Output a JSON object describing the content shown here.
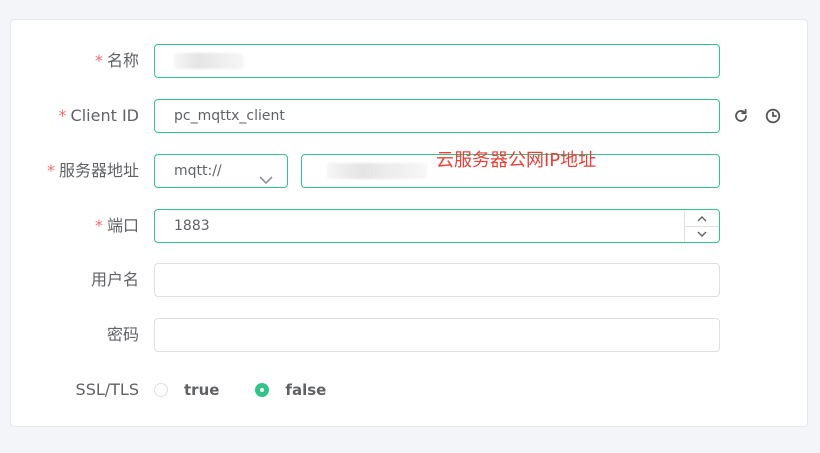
{
  "form": {
    "name": {
      "label": "名称",
      "required": true
    },
    "client_id": {
      "label": "Client ID",
      "required": true,
      "value": "pc_mqttx_client",
      "refresh_icon": "refresh-icon",
      "clock_icon": "clock-icon"
    },
    "server": {
      "label": "服务器地址",
      "required": true,
      "protocol": "mqtt://",
      "annotation": "云服务器公网IP地址"
    },
    "port": {
      "label": "端口",
      "required": true,
      "value": "1883"
    },
    "username": {
      "label": "用户名",
      "value": ""
    },
    "password": {
      "label": "密码",
      "value": ""
    },
    "ssl": {
      "label": "SSL/TLS",
      "options": [
        "true",
        "false"
      ],
      "selected": "false"
    }
  },
  "colors": {
    "accent": "#34c388",
    "required": "#f56c6c",
    "annotation": "#e8413a"
  }
}
